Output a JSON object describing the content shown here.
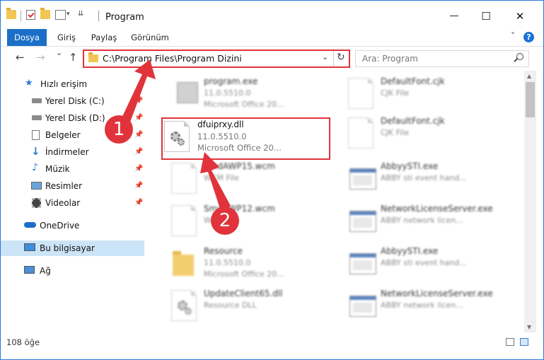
{
  "window": {
    "title": "Program",
    "minimize": "—",
    "maximize": "☐",
    "close": "✕"
  },
  "ribbon": {
    "tabs": [
      "Dosya",
      "Giriş",
      "Paylaş",
      "Görünüm"
    ],
    "help": "?"
  },
  "nav": {
    "back": "←",
    "forward": "→",
    "recent": "⌄",
    "up": "↑",
    "address": "C:\\Program Files\\Program Dizini",
    "refresh": "↻",
    "search_placeholder": "Ara: Program"
  },
  "sidebar": {
    "items": [
      {
        "label": "Hızlı erişim",
        "icon": "star-icon",
        "pinned": false
      },
      {
        "label": "Yerel Disk (C:)",
        "icon": "drive-icon",
        "pinned": true
      },
      {
        "label": "Yerel Disk (D:)",
        "icon": "drive-icon",
        "pinned": true
      },
      {
        "label": "Belgeler",
        "icon": "documents-icon",
        "pinned": true
      },
      {
        "label": "İndirmeler",
        "icon": "download-icon",
        "pinned": true
      },
      {
        "label": "Müzik",
        "icon": "music-icon",
        "pinned": true
      },
      {
        "label": "Resimler",
        "icon": "pictures-icon",
        "pinned": true
      },
      {
        "label": "Videolar",
        "icon": "video-icon",
        "pinned": true
      },
      {
        "label": "OneDrive",
        "icon": "cloud-icon",
        "pinned": false
      },
      {
        "label": "Bu bilgisayar",
        "icon": "computer-icon",
        "pinned": false,
        "selected": true
      },
      {
        "label": "Ağ",
        "icon": "network-icon",
        "pinned": false
      }
    ]
  },
  "files": [
    {
      "name": "program.exe",
      "line2": "11.0.5510.0",
      "line3": "Microsoft Office 20...",
      "icon": "exe-icon"
    },
    {
      "name": "DefaultFont.cjk",
      "line2": "CJK File",
      "line3": "",
      "icon": "document-icon"
    },
    {
      "name": "dfuiprxy.dll",
      "line2": "11.0.5510.0",
      "line3": "Microsoft Office 20...",
      "icon": "dll-gear-icon"
    },
    {
      "name": "DefaultFont.cjk",
      "line2": "CJK File",
      "line3": "",
      "icon": "document-icon"
    },
    {
      "name": "SmdAWP15.wcm",
      "line2": "WCM File",
      "line3": "",
      "icon": "document-icon"
    },
    {
      "name": "AbbyySTI.exe",
      "line2": "ABBY sti event hand...",
      "line3": "",
      "icon": "app-window-icon"
    },
    {
      "name": "SmdAWP12.wcm",
      "line2": "WCM File",
      "line3": "",
      "icon": "document-icon"
    },
    {
      "name": "NetworkLicenseServer.exe",
      "line2": "ABBY network licen...",
      "line3": "",
      "icon": "app-window-icon"
    },
    {
      "name": "Resource",
      "line2": "11.0.5510.0",
      "line3": "Microsoft Office 20...",
      "icon": "folder-icon"
    },
    {
      "name": "AbbyySTI.exe",
      "line2": "ABBY sti event hand...",
      "line3": "",
      "icon": "app-window-icon"
    },
    {
      "name": "UpdateClient65.dll",
      "line2": "Resource DLL",
      "line3": "",
      "icon": "dll-gear-icon"
    },
    {
      "name": "NetworkLicenseServer.exe",
      "line2": "ABBY network licen...",
      "line3": "",
      "icon": "app-window-icon"
    }
  ],
  "status": {
    "count": "108 öğe"
  },
  "callouts": {
    "step1": "1",
    "step2": "2"
  },
  "colors": {
    "accent": "#1b6fc7",
    "highlight": "#e0333b",
    "selection": "#cce4f7"
  }
}
